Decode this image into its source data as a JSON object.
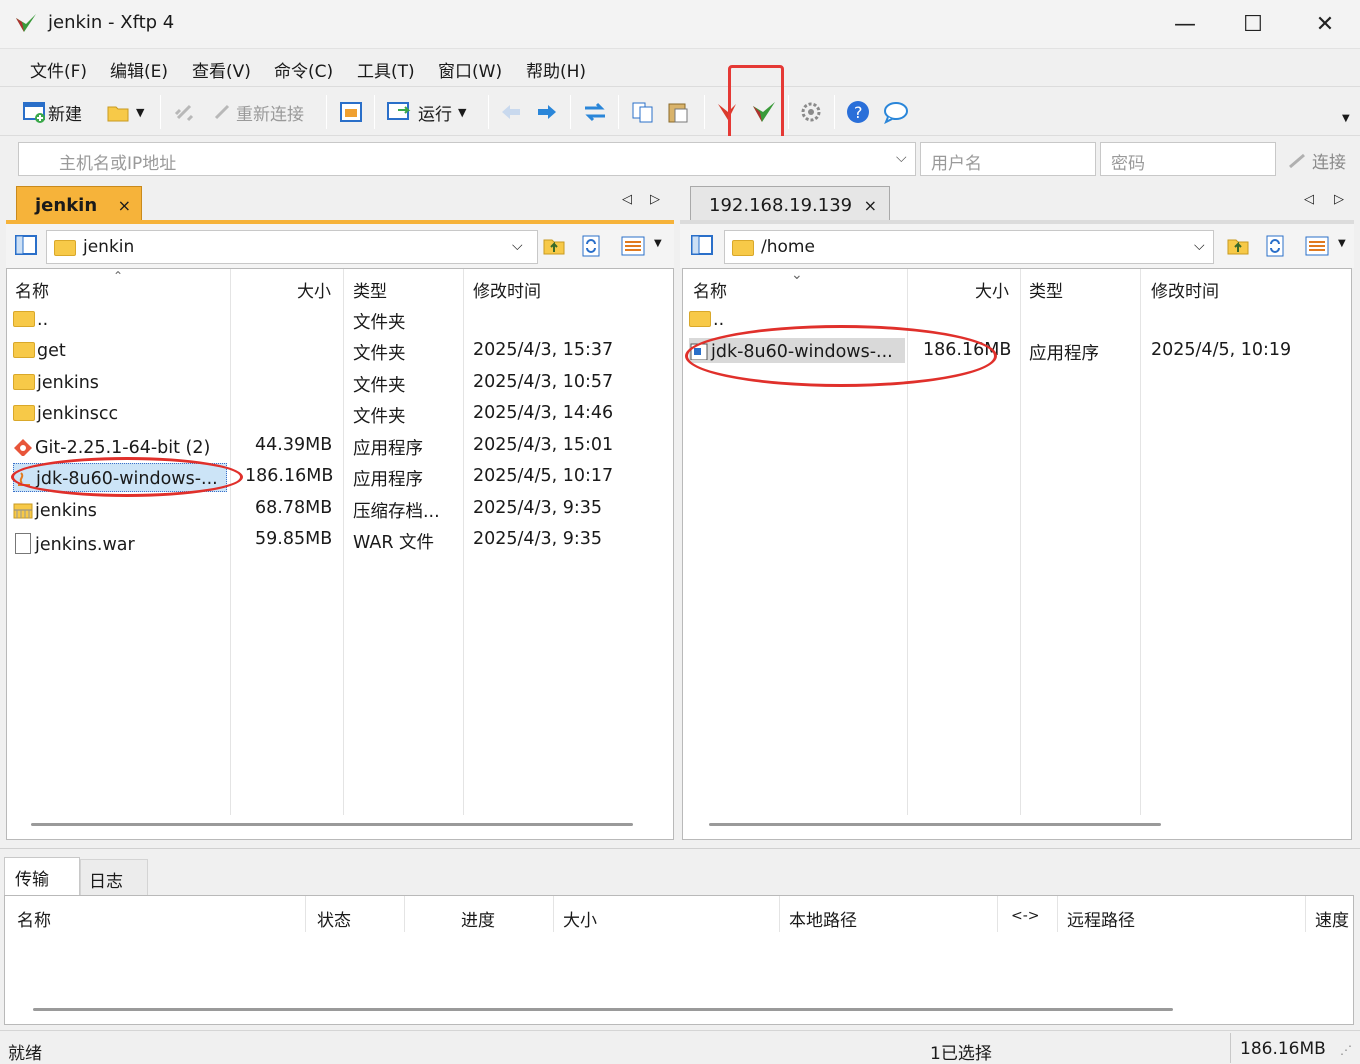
{
  "window": {
    "title": "jenkin - Xftp 4",
    "minimize": "—",
    "maximize": "☐",
    "close": "✕"
  },
  "menu": [
    "文件(F)",
    "编辑(E)",
    "查看(V)",
    "命令(C)",
    "工具(T)",
    "窗口(W)",
    "帮助(H)"
  ],
  "toolbar": {
    "new": "新建",
    "reconnect": "重新连接",
    "run": "运行"
  },
  "address": {
    "host_placeholder": "主机名或IP地址",
    "user_placeholder": "用户名",
    "password_placeholder": "密码",
    "connect": "连接"
  },
  "left": {
    "tab": "jenkin",
    "tab_close": "×",
    "path": "jenkin",
    "columns": [
      "名称",
      "大小",
      "类型",
      "修改时间"
    ],
    "rows": [
      {
        "name": "..",
        "size": "",
        "type": "文件夹",
        "date": ""
      },
      {
        "name": "get",
        "size": "",
        "type": "文件夹",
        "date": "2025/4/3, 15:37"
      },
      {
        "name": "jenkins",
        "size": "",
        "type": "文件夹",
        "date": "2025/4/3, 10:57"
      },
      {
        "name": "jenkinscc",
        "size": "",
        "type": "文件夹",
        "date": "2025/4/3, 14:46"
      },
      {
        "name": "Git-2.25.1-64-bit (2)",
        "size": "44.39MB",
        "type": "应用程序",
        "date": "2025/4/3, 15:01"
      },
      {
        "name": "jdk-8u60-windows-...",
        "size": "186.16MB",
        "type": "应用程序",
        "date": "2025/4/5, 10:17"
      },
      {
        "name": "jenkins",
        "size": "68.78MB",
        "type": "压缩存档...",
        "date": "2025/4/3, 9:35"
      },
      {
        "name": "jenkins.war",
        "size": "59.85MB",
        "type": "WAR 文件",
        "date": "2025/4/3, 9:35"
      }
    ]
  },
  "right": {
    "tab": "192.168.19.139",
    "tab_close": "×",
    "path": "/home",
    "columns": [
      "名称",
      "大小",
      "类型",
      "修改时间"
    ],
    "rows": [
      {
        "name": "..",
        "size": "",
        "type": "",
        "date": ""
      },
      {
        "name": "jdk-8u60-windows-...",
        "size": "186.16MB",
        "type": "应用程序",
        "date": "2025/4/5, 10:19"
      }
    ]
  },
  "transfer": {
    "tabs": [
      "传输",
      "日志"
    ],
    "columns": [
      "名称",
      "状态",
      "进度",
      "大小",
      "本地路径",
      "<->",
      "远程路径",
      "速度"
    ]
  },
  "status": {
    "left": "就绪",
    "mid": "1已选择",
    "right": "186.16MB"
  },
  "colors": {
    "accent": "#f5a623",
    "highlight": "#e53935"
  }
}
